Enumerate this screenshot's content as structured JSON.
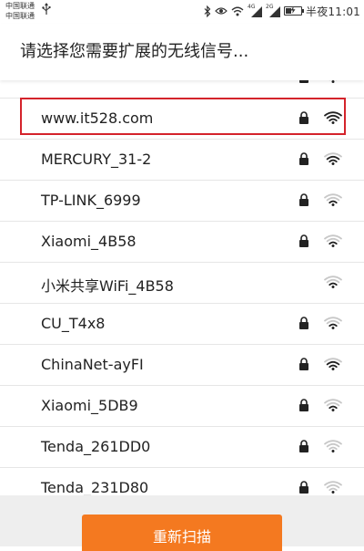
{
  "status_bar": {
    "carrier_1": "中国联通",
    "carrier_2": "中国联通",
    "time": "半夜11:01",
    "network_1": "4G",
    "network_2": "2G"
  },
  "header": {
    "title": "请选择您需要扩展的无线信号..."
  },
  "networks": [
    {
      "name": "",
      "locked": true,
      "signal": 3
    },
    {
      "name": "www.it528.com",
      "locked": true,
      "signal": 4,
      "highlighted": true
    },
    {
      "name": "MERCURY_31-2",
      "locked": true,
      "signal": 3
    },
    {
      "name": "TP-LINK_6999",
      "locked": true,
      "signal": 2
    },
    {
      "name": "Xiaomi_4B58",
      "locked": true,
      "signal": 2
    },
    {
      "name": "小米共享WiFi_4B58",
      "locked": false,
      "signal": 2
    },
    {
      "name": "CU_T4x8",
      "locked": true,
      "signal": 2
    },
    {
      "name": "ChinaNet-ayFI",
      "locked": true,
      "signal": 3
    },
    {
      "name": "Xiaomi_5DB9",
      "locked": true,
      "signal": 2
    },
    {
      "name": "Tenda_261DD0",
      "locked": true,
      "signal": 1
    },
    {
      "name": "Tenda_231D80",
      "locked": true,
      "signal": 1
    }
  ],
  "footer": {
    "rescan_label": "重新扫描"
  },
  "colors": {
    "accent": "#f47920",
    "highlight": "#d4232b",
    "icon": "#222222",
    "icon_dim": "#c8c8c8"
  },
  "icons": {
    "lock": "lock-icon",
    "wifi": "wifi-signal-icon",
    "usb": "usb-icon",
    "bluetooth": "bluetooth-icon",
    "eye": "eye-icon",
    "battery": "battery-icon"
  }
}
